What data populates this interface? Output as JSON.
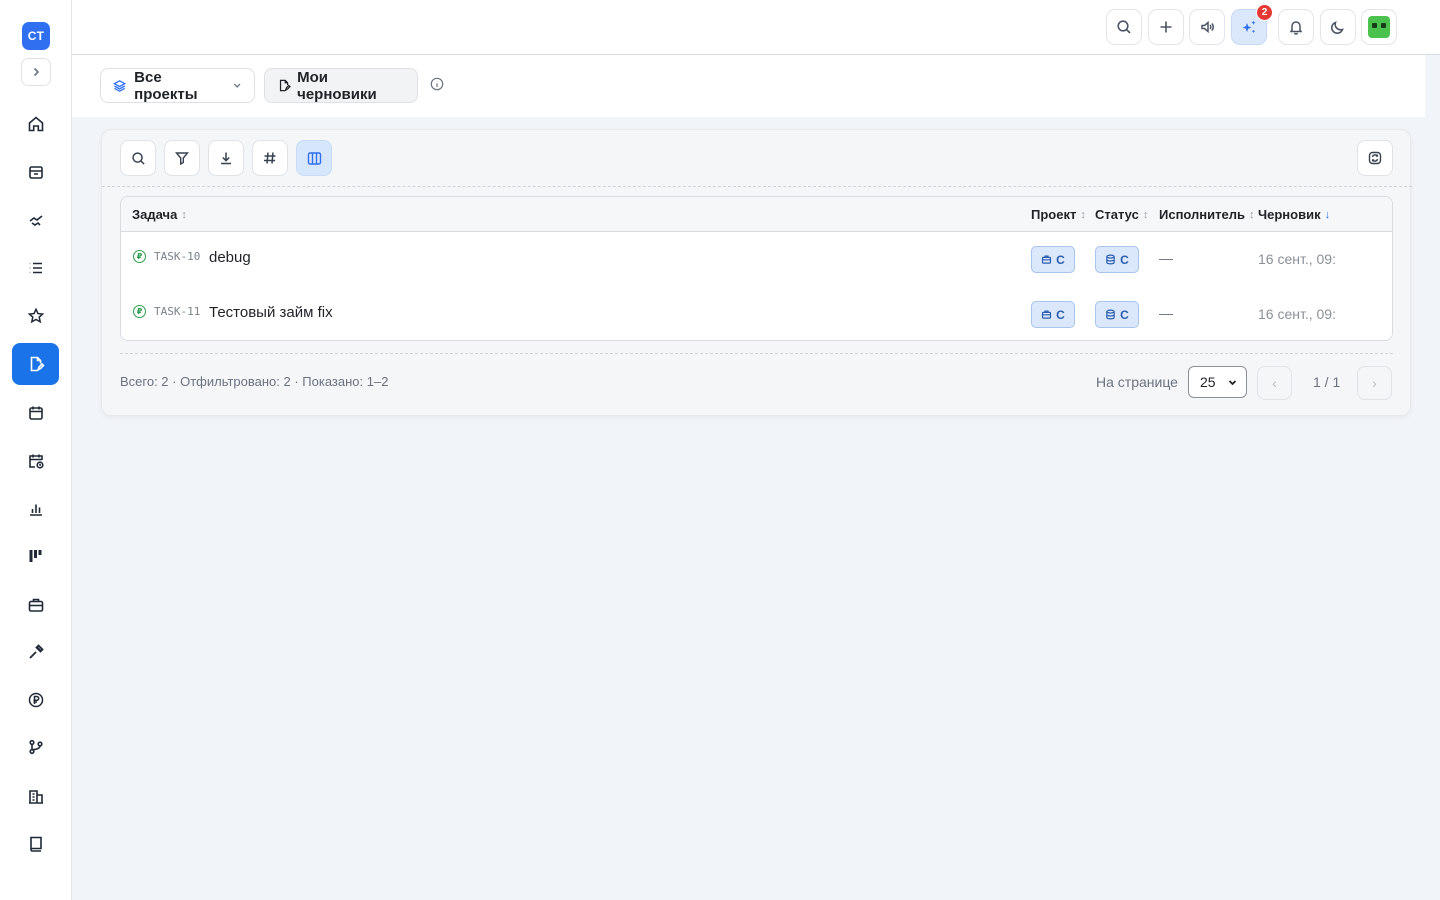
{
  "app": {
    "logo_text": "CT"
  },
  "sidebar": {
    "items": [
      {
        "icon": "home-icon"
      },
      {
        "icon": "inbox-icon"
      },
      {
        "icon": "handshake-icon"
      },
      {
        "icon": "list-icon"
      },
      {
        "icon": "star-icon"
      },
      {
        "icon": "drafts-icon",
        "active": true
      },
      {
        "icon": "calendar-icon"
      },
      {
        "icon": "calendar-clock-icon"
      },
      {
        "icon": "bar-chart-icon"
      },
      {
        "icon": "kanban-icon"
      },
      {
        "icon": "briefcase-icon"
      },
      {
        "icon": "tools-icon"
      },
      {
        "icon": "ruble-icon"
      },
      {
        "icon": "git-branch-icon"
      },
      {
        "icon": "building-icon"
      },
      {
        "icon": "book-icon"
      }
    ]
  },
  "header": {
    "ai_badge_count": "2"
  },
  "toolbar": {
    "project_select_label": "Все проекты",
    "drafts_label": "Мои черновики"
  },
  "table": {
    "columns": {
      "task": "Задача",
      "project": "Проект",
      "status": "Статус",
      "assignee": "Исполнитель",
      "draft": "Черновик"
    },
    "rows": [
      {
        "key": "TASK-10",
        "title": "debug",
        "project_chip": "C",
        "status_chip": "C",
        "assignee": "—",
        "draft_date": "16 сент., 09:"
      },
      {
        "key": "TASK-11",
        "title": "Тестовый займ fix",
        "project_chip": "C",
        "status_chip": "C",
        "assignee": "—",
        "draft_date": "16 сент., 09:"
      }
    ]
  },
  "footer": {
    "summary": "Всего: 2 · Отфильтровано: 2 · Показано: 1–2",
    "per_page_label": "На странице",
    "per_page_value": "25",
    "page_info": "1 / 1",
    "prev": "‹",
    "next": "›"
  },
  "colors": {
    "accent": "#1a73e8",
    "status_green": "#2e9e4f",
    "badge_red": "#e53935"
  }
}
